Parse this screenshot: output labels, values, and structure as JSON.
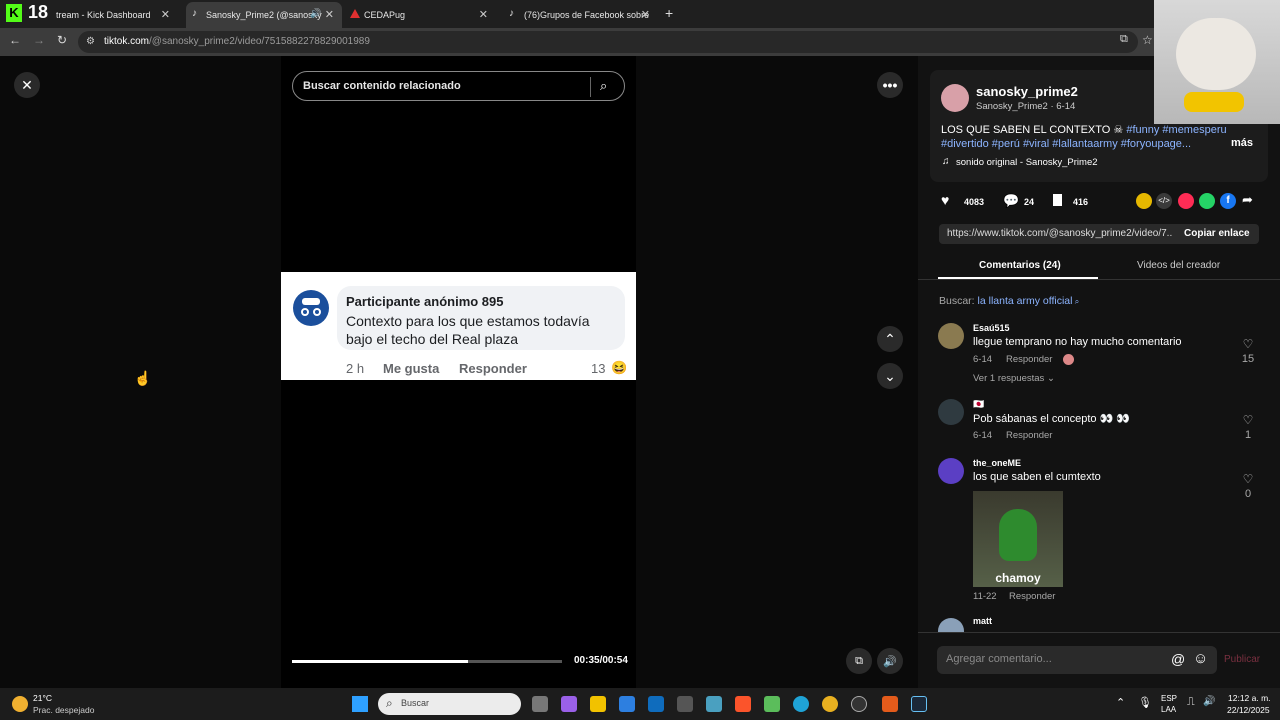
{
  "browser": {
    "tabs": [
      {
        "label": "tream - Kick Dashboard"
      },
      {
        "label": "Sanosky_Prime2 (@sanosky"
      },
      {
        "label": "CEDAPug"
      },
      {
        "label": "(76)Grupos de Facebook sobre"
      }
    ],
    "url_host": "tiktok.com",
    "url_path": "/@sanosky_prime2/video/7515882278829001989",
    "badge": "18"
  },
  "video": {
    "search_placeholder": "Buscar contenido relacionado",
    "time": "00:35/00:54",
    "progress": 0.65,
    "embedded": {
      "author": "Participante anónimo 895",
      "text1": "Contexto para los que estamos todavía",
      "text2": "bajo el techo del Real plaza",
      "time": "2 h",
      "like": "Me gusta",
      "reply": "Responder",
      "count": "13"
    }
  },
  "post": {
    "username": "sanosky_prime2",
    "sub": "Sanosky_Prime2 · 6-14",
    "caption": "LOS QUE SABEN EL CONTEXTO",
    "tags1": "#funny #memesperu",
    "tags2": "#divertido #perú #viral #lallantaarmy #foryoupage...",
    "more": "más",
    "sound": "sonido original - Sanosky_Prime2",
    "likes": "4083",
    "comments": "24",
    "saves": "416",
    "link": "https://www.tiktok.com/@sanosky_prime2/video/7...",
    "copy": "Copiar enlace"
  },
  "tabs": {
    "comments": "Comentarios (24)",
    "videos": "Videos del creador"
  },
  "search_hint": {
    "label": "Buscar:",
    "term": "la llanta army official"
  },
  "comments": [
    {
      "user": "Esaú515",
      "text": "llegue temprano no hay mucho comentario",
      "date": "6-14",
      "reply": "Responder",
      "likes": "15",
      "replies": "Ver 1 respuestas"
    },
    {
      "user": "🇯🇵",
      "text": "Pob sábanas el concepto 👀 👀",
      "date": "6-14",
      "reply": "Responder",
      "likes": "1"
    },
    {
      "user": "the_oneME",
      "text": "los que saben el cumtexto",
      "date": "11-22",
      "reply": "Responder",
      "likes": "0",
      "sticker": "chamoy"
    },
    {
      "user": "matt"
    }
  ],
  "composer": {
    "placeholder": "Agregar comentario...",
    "publish": "Publicar"
  },
  "taskbar": {
    "temp": "21°C",
    "weather": "Prac. despejado",
    "search": "Buscar",
    "lang1": "ESP",
    "lang2": "LAA",
    "time": "12:12 a. m.",
    "date": "22/12/2025"
  }
}
